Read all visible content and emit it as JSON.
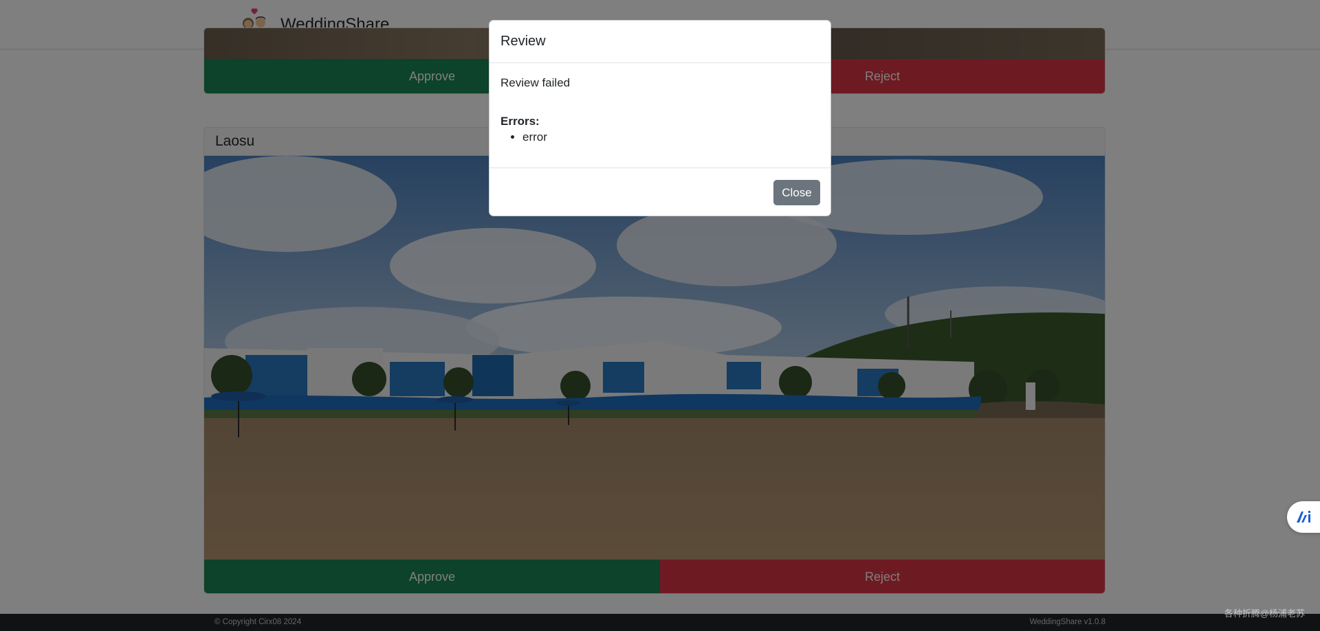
{
  "navbar": {
    "brand": "WeddingShare"
  },
  "review_items": [
    {
      "approve_label": "Approve",
      "reject_label": "Reject"
    },
    {
      "uploader": "Laosu",
      "approve_label": "Approve",
      "reject_label": "Reject"
    }
  ],
  "footer": {
    "copyright": "© Copyright Cirx08 2024",
    "version": "WeddingShare v1.0.8"
  },
  "modal": {
    "title": "Review",
    "message": "Review failed",
    "errors_label": "Errors:",
    "errors": [
      "error"
    ],
    "close_label": "Close"
  },
  "watermark": "各种折腾@杨浦老苏",
  "colors": {
    "approve": "#198754",
    "reject": "#dc3545",
    "close_button": "#6c757d",
    "footer": "#212529"
  },
  "icons": {
    "brand": "couple-icon",
    "side_widget": "ai-assistant-icon"
  }
}
